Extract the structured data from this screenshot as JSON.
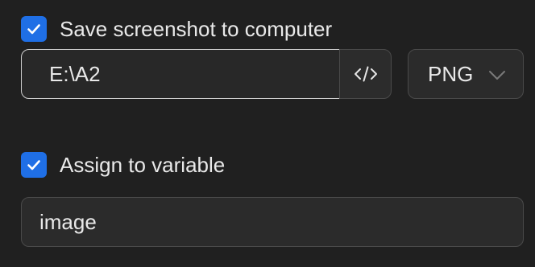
{
  "save_section": {
    "checked": true,
    "label": "Save screenshot to computer",
    "path_value": "E:\\A2",
    "browse_icon": "code-icon",
    "format_value": "PNG",
    "format_icon": "chevron-down-icon"
  },
  "variable_section": {
    "checked": true,
    "label": "Assign to variable",
    "variable_value": "image"
  },
  "colors": {
    "background": "#202020",
    "checkbox_accent": "#1f6fe6",
    "text": "#e9e9e9",
    "field_border": "#4a4a4a",
    "focused_border": "#cfcfcf"
  }
}
